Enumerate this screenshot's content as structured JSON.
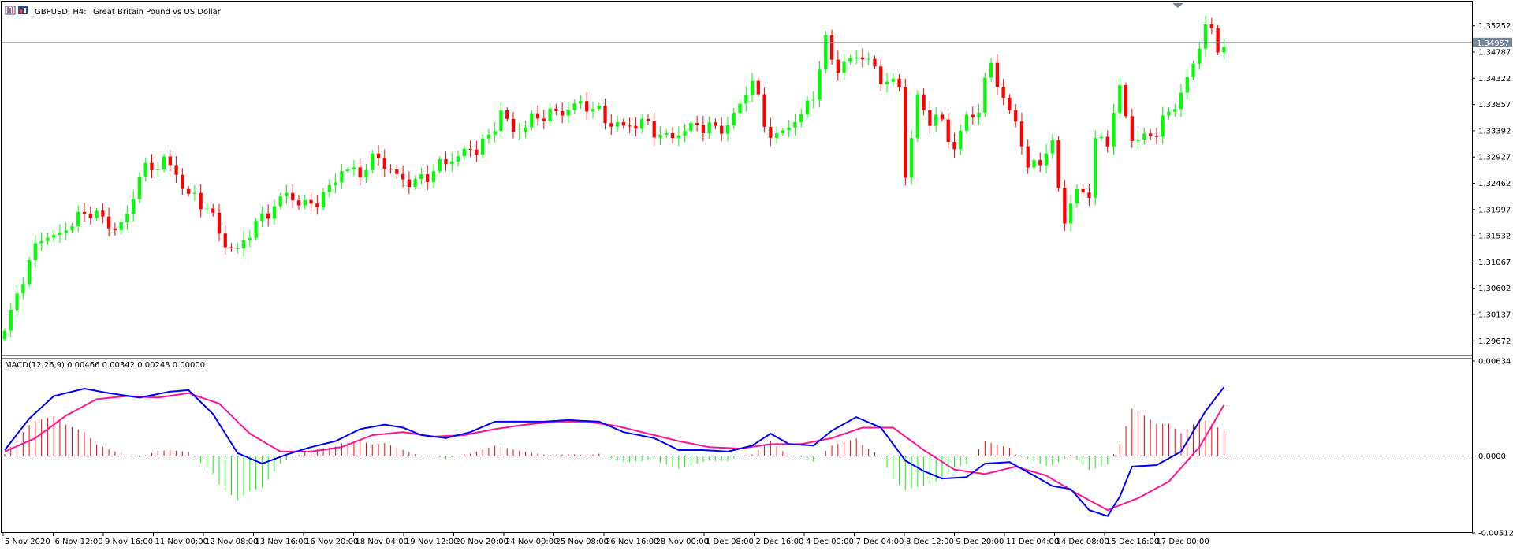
{
  "header": {
    "symbol": "GBPUSD, H4:",
    "description": "Great Britain Pound vs US Dollar"
  },
  "indicator": {
    "label": "MACD(12,26,9) 0.00466 0.00342 0.00248 0.00000"
  },
  "colors": {
    "bull": "#00ff00",
    "bear": "#ff0000",
    "macd_line": "#0000ff",
    "signal_line": "#ff1493",
    "price_line": "#778899",
    "price_tag_bg": "#778899",
    "axis": "#000000"
  },
  "chart_data": [
    {
      "type": "candlestick",
      "symbol": "GBPUSD",
      "timeframe": "H4",
      "title": "GBPUSD, H4:  Great Britain Pound vs US Dollar",
      "current_price": "1.34957",
      "ylim": [
        1.29439,
        1.35625
      ],
      "y_ticks": [
        "1.35252",
        "1.34787",
        "1.34322",
        "1.33857",
        "1.33392",
        "1.32927",
        "1.32462",
        "1.31997",
        "1.31532",
        "1.31067",
        "1.30602",
        "1.30137",
        "1.29672"
      ],
      "x_ticks": [
        "5 Nov 2020",
        "6 Nov 12:00",
        "9 Nov 16:00",
        "11 Nov 00:00",
        "12 Nov 08:00",
        "13 Nov 16:00",
        "16 Nov 20:00",
        "18 Nov 04:00",
        "19 Nov 12:00",
        "20 Nov 20:00",
        "24 Nov 00:00",
        "25 Nov 08:00",
        "26 Nov 16:00",
        "28 Nov 00:00",
        "1 Dec 08:00",
        "2 Dec 16:00",
        "4 Dec 00:00",
        "7 Dec 04:00",
        "8 Dec 12:00",
        "9 Dec 20:00",
        "11 Dec 04:00",
        "14 Dec 08:00",
        "15 Dec 16:00",
        "17 Dec 00:00"
      ],
      "close_path": [
        {
          "x": 0,
          "close": 1.2985
        },
        {
          "x": 3,
          "close": 1.308
        },
        {
          "x": 6,
          "close": 1.3155
        },
        {
          "x": 8,
          "close": 1.3148
        },
        {
          "x": 12,
          "close": 1.3185
        },
        {
          "x": 14,
          "close": 1.3198
        },
        {
          "x": 18,
          "close": 1.3165
        },
        {
          "x": 20,
          "close": 1.3185
        },
        {
          "x": 22,
          "close": 1.3265
        },
        {
          "x": 24,
          "close": 1.3272
        },
        {
          "x": 26,
          "close": 1.3288
        },
        {
          "x": 28,
          "close": 1.3262
        },
        {
          "x": 30,
          "close": 1.3225
        },
        {
          "x": 33,
          "close": 1.3205
        },
        {
          "x": 36,
          "close": 1.3138
        },
        {
          "x": 38,
          "close": 1.3125
        },
        {
          "x": 40,
          "close": 1.3162
        },
        {
          "x": 43,
          "close": 1.3195
        },
        {
          "x": 46,
          "close": 1.3228
        },
        {
          "x": 49,
          "close": 1.3205
        },
        {
          "x": 52,
          "close": 1.3222
        },
        {
          "x": 55,
          "close": 1.327
        },
        {
          "x": 58,
          "close": 1.3265
        },
        {
          "x": 61,
          "close": 1.3295
        },
        {
          "x": 63,
          "close": 1.3265
        },
        {
          "x": 66,
          "close": 1.3248
        },
        {
          "x": 68,
          "close": 1.3252
        },
        {
          "x": 71,
          "close": 1.3278
        },
        {
          "x": 74,
          "close": 1.3295
        },
        {
          "x": 77,
          "close": 1.331
        },
        {
          "x": 79,
          "close": 1.3325
        },
        {
          "x": 81,
          "close": 1.3375
        },
        {
          "x": 83,
          "close": 1.3335
        },
        {
          "x": 86,
          "close": 1.3358
        },
        {
          "x": 88,
          "close": 1.3368
        },
        {
          "x": 91,
          "close": 1.3372
        },
        {
          "x": 93,
          "close": 1.3385
        },
        {
          "x": 96,
          "close": 1.3382
        },
        {
          "x": 98,
          "close": 1.3358
        },
        {
          "x": 101,
          "close": 1.3345
        },
        {
          "x": 104,
          "close": 1.3355
        },
        {
          "x": 106,
          "close": 1.334
        },
        {
          "x": 108,
          "close": 1.3325
        },
        {
          "x": 110,
          "close": 1.3335
        },
        {
          "x": 113,
          "close": 1.335
        },
        {
          "x": 116,
          "close": 1.3342
        },
        {
          "x": 118,
          "close": 1.3348
        },
        {
          "x": 120,
          "close": 1.3385
        },
        {
          "x": 122,
          "close": 1.3432
        },
        {
          "x": 124,
          "close": 1.335
        },
        {
          "x": 126,
          "close": 1.3325
        },
        {
          "x": 128,
          "close": 1.335
        },
        {
          "x": 130,
          "close": 1.3365
        },
        {
          "x": 132,
          "close": 1.3405
        },
        {
          "x": 134,
          "close": 1.3495
        },
        {
          "x": 136,
          "close": 1.3448
        },
        {
          "x": 138,
          "close": 1.3465
        },
        {
          "x": 140,
          "close": 1.3475
        },
        {
          "x": 142,
          "close": 1.3445
        },
        {
          "x": 144,
          "close": 1.3425
        },
        {
          "x": 146,
          "close": 1.342
        },
        {
          "x": 147,
          "close": 1.326
        },
        {
          "x": 149,
          "close": 1.3395
        },
        {
          "x": 151,
          "close": 1.336
        },
        {
          "x": 153,
          "close": 1.3355
        },
        {
          "x": 155,
          "close": 1.3305
        },
        {
          "x": 157,
          "close": 1.3365
        },
        {
          "x": 159,
          "close": 1.3375
        },
        {
          "x": 161,
          "close": 1.3465
        },
        {
          "x": 163,
          "close": 1.3388
        },
        {
          "x": 165,
          "close": 1.336
        },
        {
          "x": 167,
          "close": 1.327
        },
        {
          "x": 169,
          "close": 1.329
        },
        {
          "x": 171,
          "close": 1.331
        },
        {
          "x": 173,
          "close": 1.318
        },
        {
          "x": 175,
          "close": 1.3232
        },
        {
          "x": 177,
          "close": 1.323
        },
        {
          "x": 178,
          "close": 1.3318
        },
        {
          "x": 180,
          "close": 1.3325
        },
        {
          "x": 182,
          "close": 1.3412
        },
        {
          "x": 184,
          "close": 1.3325
        },
        {
          "x": 186,
          "close": 1.3325
        },
        {
          "x": 188,
          "close": 1.334
        },
        {
          "x": 190,
          "close": 1.337
        },
        {
          "x": 192,
          "close": 1.3405
        },
        {
          "x": 194,
          "close": 1.3455
        },
        {
          "x": 196,
          "close": 1.353
        },
        {
          "x": 198,
          "close": 1.3485
        },
        {
          "x": 199,
          "close": 1.3496
        }
      ]
    },
    {
      "type": "macd",
      "title": "MACD(12,26,9) 0.00466 0.00342 0.00248 0.00000",
      "ylim": [
        -0.00512,
        0.00634
      ],
      "y_ticks": [
        "0.00634",
        "0.0000",
        "-0.00512"
      ],
      "series": [
        {
          "name": "MACD",
          "points": [
            {
              "x": 0,
              "v": 0.0004
            },
            {
              "x": 4,
              "v": 0.0025
            },
            {
              "x": 8,
              "v": 0.004
            },
            {
              "x": 13,
              "v": 0.0045
            },
            {
              "x": 17,
              "v": 0.0042
            },
            {
              "x": 22,
              "v": 0.0039
            },
            {
              "x": 27,
              "v": 0.0043
            },
            {
              "x": 30,
              "v": 0.0044
            },
            {
              "x": 34,
              "v": 0.0028
            },
            {
              "x": 38,
              "v": 0.0002
            },
            {
              "x": 42,
              "v": -0.0005
            },
            {
              "x": 46,
              "v": 0.0001
            },
            {
              "x": 50,
              "v": 0.0006
            },
            {
              "x": 54,
              "v": 0.001
            },
            {
              "x": 58,
              "v": 0.0018
            },
            {
              "x": 62,
              "v": 0.0021
            },
            {
              "x": 65,
              "v": 0.0019
            },
            {
              "x": 68,
              "v": 0.0014
            },
            {
              "x": 72,
              "v": 0.0012
            },
            {
              "x": 76,
              "v": 0.0016
            },
            {
              "x": 80,
              "v": 0.0023
            },
            {
              "x": 84,
              "v": 0.0023
            },
            {
              "x": 88,
              "v": 0.0023
            },
            {
              "x": 92,
              "v": 0.0024
            },
            {
              "x": 97,
              "v": 0.0023
            },
            {
              "x": 101,
              "v": 0.0016
            },
            {
              "x": 106,
              "v": 0.0012
            },
            {
              "x": 110,
              "v": 0.0004
            },
            {
              "x": 114,
              "v": 0.0004
            },
            {
              "x": 118,
              "v": 0.0003
            },
            {
              "x": 122,
              "v": 0.0007
            },
            {
              "x": 125,
              "v": 0.0015
            },
            {
              "x": 128,
              "v": 0.0008
            },
            {
              "x": 132,
              "v": 0.0007
            },
            {
              "x": 135,
              "v": 0.0017
            },
            {
              "x": 139,
              "v": 0.0026
            },
            {
              "x": 143,
              "v": 0.0019
            },
            {
              "x": 147,
              "v": -0.0003
            },
            {
              "x": 150,
              "v": -0.001
            },
            {
              "x": 153,
              "v": -0.0015
            },
            {
              "x": 157,
              "v": -0.0014
            },
            {
              "x": 160,
              "v": -0.0005
            },
            {
              "x": 164,
              "v": -0.0004
            },
            {
              "x": 168,
              "v": -0.0013
            },
            {
              "x": 171,
              "v": -0.002
            },
            {
              "x": 174,
              "v": -0.0022
            },
            {
              "x": 177,
              "v": -0.0036
            },
            {
              "x": 180,
              "v": -0.004
            },
            {
              "x": 182,
              "v": -0.0027
            },
            {
              "x": 184,
              "v": -0.0007
            },
            {
              "x": 188,
              "v": -0.0006
            },
            {
              "x": 192,
              "v": 0.0003
            },
            {
              "x": 196,
              "v": 0.003
            },
            {
              "x": 199,
              "v": 0.0046
            }
          ]
        },
        {
          "name": "Signal",
          "points": [
            {
              "x": 0,
              "v": 0.0003
            },
            {
              "x": 5,
              "v": 0.0012
            },
            {
              "x": 10,
              "v": 0.0027
            },
            {
              "x": 15,
              "v": 0.0038
            },
            {
              "x": 20,
              "v": 0.004
            },
            {
              "x": 25,
              "v": 0.0039
            },
            {
              "x": 30,
              "v": 0.0042
            },
            {
              "x": 35,
              "v": 0.0035
            },
            {
              "x": 40,
              "v": 0.0015
            },
            {
              "x": 45,
              "v": 0.0003
            },
            {
              "x": 50,
              "v": 0.0003
            },
            {
              "x": 55,
              "v": 0.0006
            },
            {
              "x": 60,
              "v": 0.0014
            },
            {
              "x": 65,
              "v": 0.0016
            },
            {
              "x": 70,
              "v": 0.0013
            },
            {
              "x": 75,
              "v": 0.0014
            },
            {
              "x": 80,
              "v": 0.0018
            },
            {
              "x": 85,
              "v": 0.0021
            },
            {
              "x": 90,
              "v": 0.0023
            },
            {
              "x": 95,
              "v": 0.0023
            },
            {
              "x": 100,
              "v": 0.002
            },
            {
              "x": 105,
              "v": 0.0015
            },
            {
              "x": 110,
              "v": 0.001
            },
            {
              "x": 115,
              "v": 0.0006
            },
            {
              "x": 120,
              "v": 0.0005
            },
            {
              "x": 125,
              "v": 0.0008
            },
            {
              "x": 130,
              "v": 0.0008
            },
            {
              "x": 135,
              "v": 0.0012
            },
            {
              "x": 140,
              "v": 0.0019
            },
            {
              "x": 145,
              "v": 0.0019
            },
            {
              "x": 150,
              "v": 0.0004
            },
            {
              "x": 155,
              "v": -0.0009
            },
            {
              "x": 160,
              "v": -0.0012
            },
            {
              "x": 165,
              "v": -0.0007
            },
            {
              "x": 170,
              "v": -0.0013
            },
            {
              "x": 175,
              "v": -0.0025
            },
            {
              "x": 180,
              "v": -0.0036
            },
            {
              "x": 185,
              "v": -0.0028
            },
            {
              "x": 190,
              "v": -0.0017
            },
            {
              "x": 195,
              "v": 0.0006
            },
            {
              "x": 199,
              "v": 0.0034
            }
          ]
        }
      ]
    }
  ]
}
